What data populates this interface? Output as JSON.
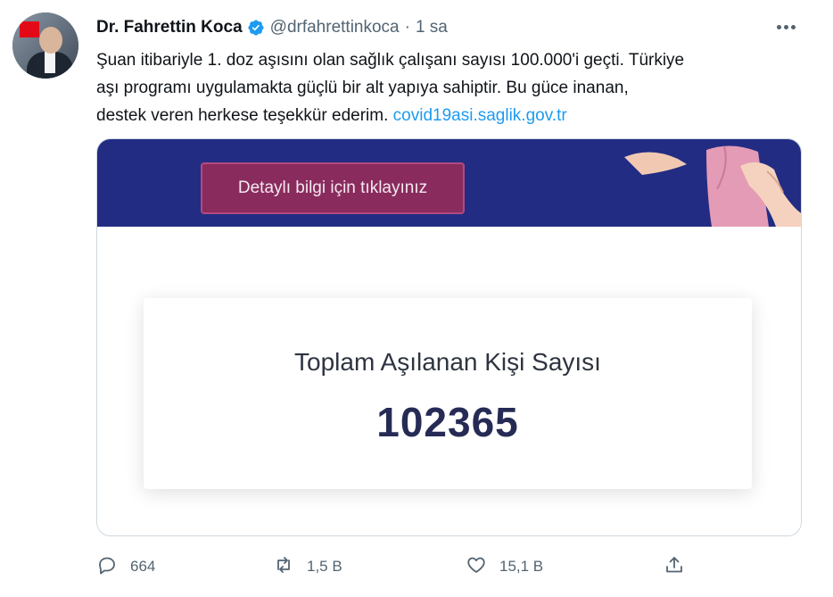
{
  "author": {
    "name": "Dr. Fahrettin Koca",
    "handle": "@drfahrettinkoca",
    "separator": "·",
    "time": "1 sa"
  },
  "tweet": {
    "lines": [
      "Şuan itibariyle 1. doz aşısını olan sağlık çalışanı sayısı 100.000'i geçti. Türkiye",
      "aşı programı uygulamakta güçlü bir alt yapıya sahiptir. Bu güce inanan,",
      "destek veren herkese teşekkür ederim. "
    ],
    "link_text": "covid19asi.saglik.gov.tr"
  },
  "card": {
    "cta_label": "Detaylı bilgi için tıklayınız",
    "stat_label": "Toplam Aşılanan Kişi Sayısı",
    "stat_value": "102365"
  },
  "actions": {
    "reply_count": "664",
    "retweet_count": "1,5 B",
    "like_count": "15,1 B"
  },
  "icons": {
    "verified": "verified-badge-icon",
    "more": "more-options-icon",
    "reply": "reply-icon",
    "retweet": "retweet-icon",
    "like": "heart-icon",
    "share": "share-icon"
  },
  "colors": {
    "link": "#1d9bf0",
    "banner": "#232c83",
    "cta": "#8a2b5d",
    "stat_value": "#262b55"
  }
}
